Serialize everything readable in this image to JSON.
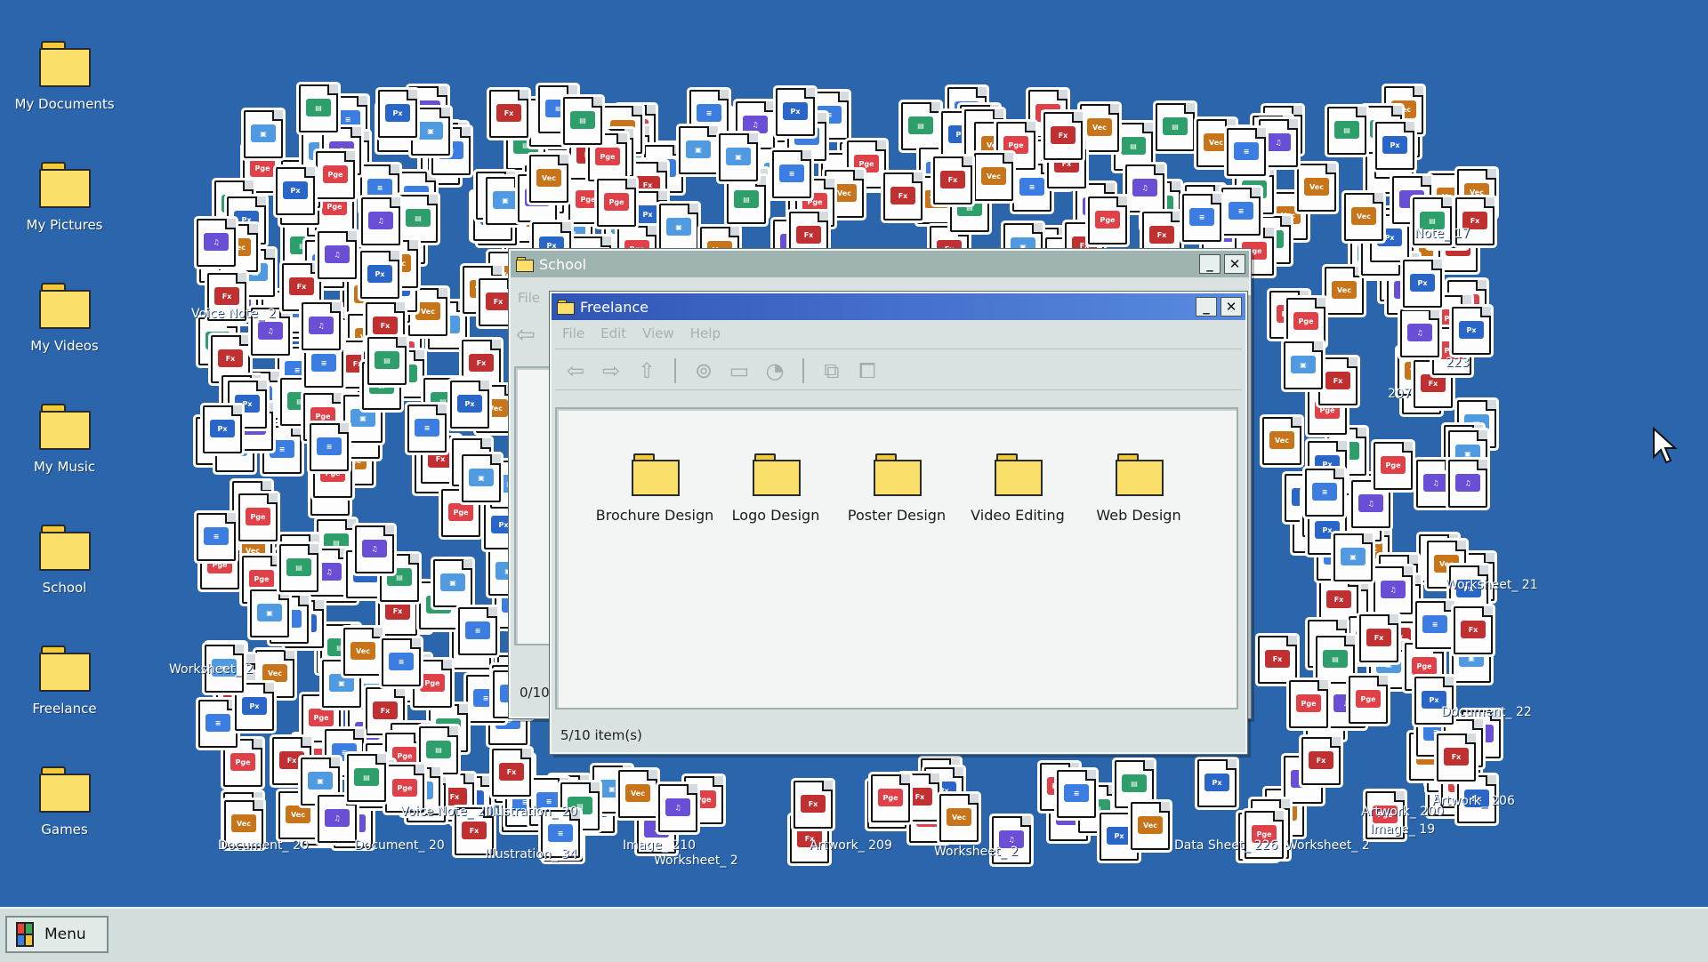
{
  "desktop_icons": [
    {
      "label": "My Documents"
    },
    {
      "label": "My Pictures"
    },
    {
      "label": "My Videos"
    },
    {
      "label": "My Music"
    },
    {
      "label": "School"
    },
    {
      "label": "Freelance"
    },
    {
      "label": "Games"
    }
  ],
  "scattered_labels": [
    "Voice Note_ 2",
    "Worksheet_ 2",
    "Document_ 20",
    "Document_ 20",
    "Illustration_ 34",
    "Image_ 210",
    "Worksheet_ 2",
    "Artwork_ 209",
    "Worksheet_ 2",
    "Data Sheet_ 226",
    "Worksheet_ 2",
    "Image_ 19",
    "Artwork_ 200",
    "Artwork_ 206",
    "Document_ 22",
    "Worksheet_ 21",
    "Note_ 17",
    "223",
    "207",
    "Voice Note_ 20",
    "Illustration_ 20"
  ],
  "file_badges": {
    "pge": "Pge",
    "px": "Px",
    "vec": "Vec",
    "fx": "Fx"
  },
  "colors": {
    "desktop": "#2b66ad",
    "doc": "#3b7de0",
    "sheet": "#2e9e6a",
    "pdf": "#e04148",
    "vec": "#c8741a",
    "px": "#2a66c8",
    "fx": "#c03030",
    "music": "#6a4fd6",
    "image": "#4f9ae0"
  },
  "window_school": {
    "title": "School",
    "menu_file": "File",
    "status": "0/10"
  },
  "window_freelance": {
    "title": "Freelance",
    "menu": [
      "File",
      "Edit",
      "View",
      "Help"
    ],
    "folders": [
      {
        "label": "Brochure Design"
      },
      {
        "label": "Logo Design"
      },
      {
        "label": "Poster Design"
      },
      {
        "label": "Video Editing"
      },
      {
        "label": "Web Design"
      }
    ],
    "status": "5/10 item(s)"
  },
  "taskbar": {
    "start_label": "Menu"
  },
  "icons": {
    "minimize": "minimize-icon",
    "close": "close-icon",
    "back": "back-arrow-icon",
    "forward": "forward-arrow-icon",
    "up": "up-folder-icon",
    "search": "search-icon",
    "folders": "folders-icon",
    "history": "history-icon",
    "copy": "copy-icon",
    "move": "move-icon",
    "cursor": "mouse-cursor-icon"
  }
}
